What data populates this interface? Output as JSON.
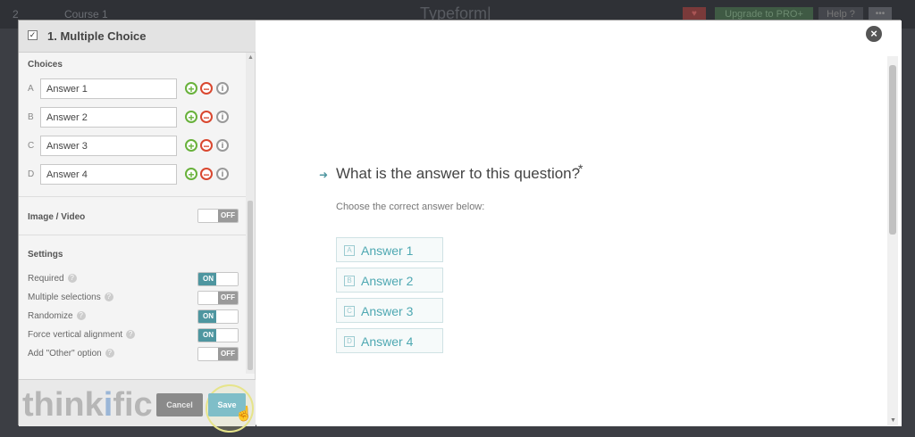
{
  "topbar": {
    "left": "2",
    "course": "Course 1",
    "title": "Typeform|",
    "upgrade": "Upgrade to PRO+",
    "help": "Help ?"
  },
  "panel": {
    "title": "1. Multiple Choice",
    "choices_label": "Choices",
    "choices": [
      {
        "letter": "A",
        "value": "Answer 1"
      },
      {
        "letter": "B",
        "value": "Answer 2"
      },
      {
        "letter": "C",
        "value": "Answer 3"
      },
      {
        "letter": "D",
        "value": "Answer 4"
      }
    ],
    "image_video_label": "Image / Video",
    "image_video_state": "OFF",
    "settings_label": "Settings",
    "settings": [
      {
        "label": "Required",
        "state": "ON"
      },
      {
        "label": "Multiple selections",
        "state": "OFF"
      },
      {
        "label": "Randomize",
        "state": "ON"
      },
      {
        "label": "Force vertical alignment",
        "state": "ON"
      },
      {
        "label": "Add \"Other\" option",
        "state": "OFF"
      }
    ],
    "cancel_label": "Cancel",
    "save_label": "Save"
  },
  "watermark": {
    "prefix": "think",
    "i": "i",
    "suffix": "fic"
  },
  "preview": {
    "question": "What is the answer to this question?",
    "required_mark": "*",
    "subtitle": "Choose the correct answer below:",
    "answers": [
      {
        "key": "A",
        "label": "Answer 1"
      },
      {
        "key": "B",
        "label": "Answer 2"
      },
      {
        "key": "C",
        "label": "Answer 3"
      },
      {
        "key": "D",
        "label": "Answer 4"
      }
    ],
    "close_symbol": "×"
  },
  "colors": {
    "accent": "#4e96a0",
    "add": "#68b13b",
    "remove": "#d9472f",
    "answer_text": "#4ea8b2"
  }
}
